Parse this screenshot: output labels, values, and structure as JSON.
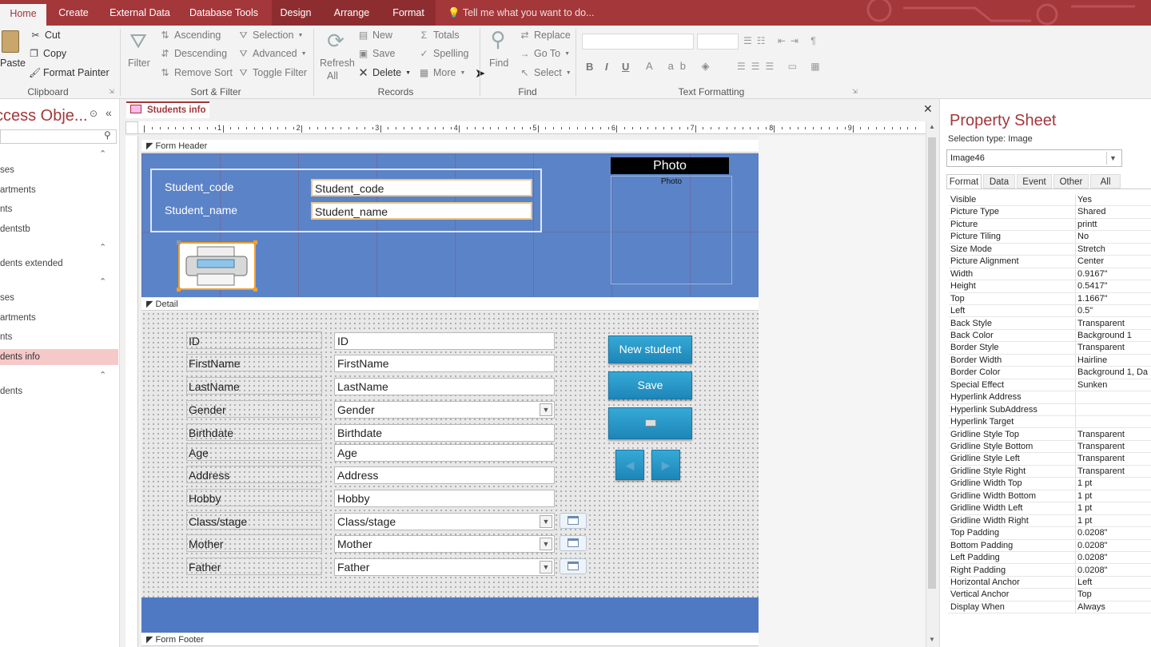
{
  "tabs": {
    "home": "Home",
    "create": "Create",
    "external": "External Data",
    "dbtools": "Database Tools",
    "design": "Design",
    "arrange": "Arrange",
    "format": "Format",
    "tellme": "Tell me what you want to do..."
  },
  "ribbon": {
    "clipboard": {
      "paste": "Paste",
      "cut": "Cut",
      "copy": "Copy",
      "format_painter": "Format Painter",
      "label": "Clipboard"
    },
    "sortfilter": {
      "filter": "Filter",
      "ascending": "Ascending",
      "descending": "Descending",
      "remove_sort": "Remove Sort",
      "selection": "Selection",
      "advanced": "Advanced",
      "toggle_filter": "Toggle Filter",
      "label": "Sort & Filter"
    },
    "records": {
      "refresh": "Refresh",
      "refresh2": "All",
      "new": "New",
      "save": "Save",
      "delete": "Delete",
      "totals": "Totals",
      "spelling": "Spelling",
      "more": "More",
      "label": "Records"
    },
    "find": {
      "find": "Find",
      "replace": "Replace",
      "goto": "Go To",
      "select": "Select",
      "label": "Find"
    },
    "textformat": {
      "label": "Text Formatting"
    }
  },
  "nav": {
    "title": "ccess Obje...",
    "items": [
      "ses",
      "artments",
      "nts",
      "dentstb",
      "dents extended",
      "ses",
      "artments",
      "nts",
      "dents info",
      "dents"
    ]
  },
  "document": {
    "tab": "Students info",
    "sections": {
      "header": "Form Header",
      "detail": "Detail",
      "footer": "Form Footer"
    }
  },
  "ruler": {
    "marks": [
      "1",
      "2",
      "3",
      "4",
      "5",
      "6",
      "7",
      "8",
      "9"
    ],
    "vmarks": [
      "1",
      "1",
      "2",
      "3"
    ]
  },
  "form_header": {
    "fields": [
      {
        "label": "Student_code",
        "value": "Student_code"
      },
      {
        "label": "Student_name",
        "value": "Student_name"
      }
    ],
    "photo_title": "Photo",
    "photo_label": "Photo"
  },
  "detail": {
    "fields": [
      {
        "label": "ID",
        "value": "ID",
        "type": "text"
      },
      {
        "label": "FirstName",
        "value": "FirstName",
        "type": "text"
      },
      {
        "label": "LastName",
        "value": "LastName",
        "type": "text"
      },
      {
        "label": "Gender",
        "value": "Gender",
        "type": "combo"
      },
      {
        "label": "Birthdate",
        "value": "Birthdate",
        "type": "text"
      },
      {
        "label": "Age",
        "value": "Age",
        "type": "text"
      },
      {
        "label": "Address",
        "value": "Address",
        "type": "text"
      },
      {
        "label": "Hobby",
        "value": "Hobby",
        "type": "text"
      },
      {
        "label": "Class/stage",
        "value": "Class/stage",
        "type": "combo"
      },
      {
        "label": "Mother",
        "value": "Mother",
        "type": "combo"
      },
      {
        "label": "Father",
        "value": "Father",
        "type": "combo"
      }
    ],
    "buttons": {
      "new_student": "New student",
      "save": "Save"
    }
  },
  "property_sheet": {
    "title": "Property Sheet",
    "selection_type": "Selection type:  Image",
    "selected": "Image46",
    "tabs": [
      "Format",
      "Data",
      "Event",
      "Other",
      "All"
    ],
    "rows": [
      [
        "Visible",
        "Yes"
      ],
      [
        "Picture Type",
        "Shared"
      ],
      [
        "Picture",
        "printt"
      ],
      [
        "Picture Tiling",
        "No"
      ],
      [
        "Size Mode",
        "Stretch"
      ],
      [
        "Picture Alignment",
        "Center"
      ],
      [
        "Width",
        "0.9167\""
      ],
      [
        "Height",
        "0.5417\""
      ],
      [
        "Top",
        "1.1667\""
      ],
      [
        "Left",
        "0.5\""
      ],
      [
        "Back Style",
        "Transparent"
      ],
      [
        "Back Color",
        "Background 1"
      ],
      [
        "Border Style",
        "Transparent"
      ],
      [
        "Border Width",
        "Hairline"
      ],
      [
        "Border Color",
        "Background 1, Da"
      ],
      [
        "Special Effect",
        "Sunken"
      ],
      [
        "Hyperlink Address",
        ""
      ],
      [
        "Hyperlink SubAddress",
        ""
      ],
      [
        "Hyperlink Target",
        ""
      ],
      [
        "Gridline Style Top",
        "Transparent"
      ],
      [
        "Gridline Style Bottom",
        "Transparent"
      ],
      [
        "Gridline Style Left",
        "Transparent"
      ],
      [
        "Gridline Style Right",
        "Transparent"
      ],
      [
        "Gridline Width Top",
        "1 pt"
      ],
      [
        "Gridline Width Bottom",
        "1 pt"
      ],
      [
        "Gridline Width Left",
        "1 pt"
      ],
      [
        "Gridline Width Right",
        "1 pt"
      ],
      [
        "Top Padding",
        "0.0208\""
      ],
      [
        "Bottom Padding",
        "0.0208\""
      ],
      [
        "Left Padding",
        "0.0208\""
      ],
      [
        "Right Padding",
        "0.0208\""
      ],
      [
        "Horizontal Anchor",
        "Left"
      ],
      [
        "Vertical Anchor",
        "Top"
      ],
      [
        "Display When",
        "Always"
      ]
    ]
  },
  "colors": {
    "accent": "#a4373a",
    "form_blue": "#5b83c8",
    "button_blue": "#2a97c8"
  }
}
